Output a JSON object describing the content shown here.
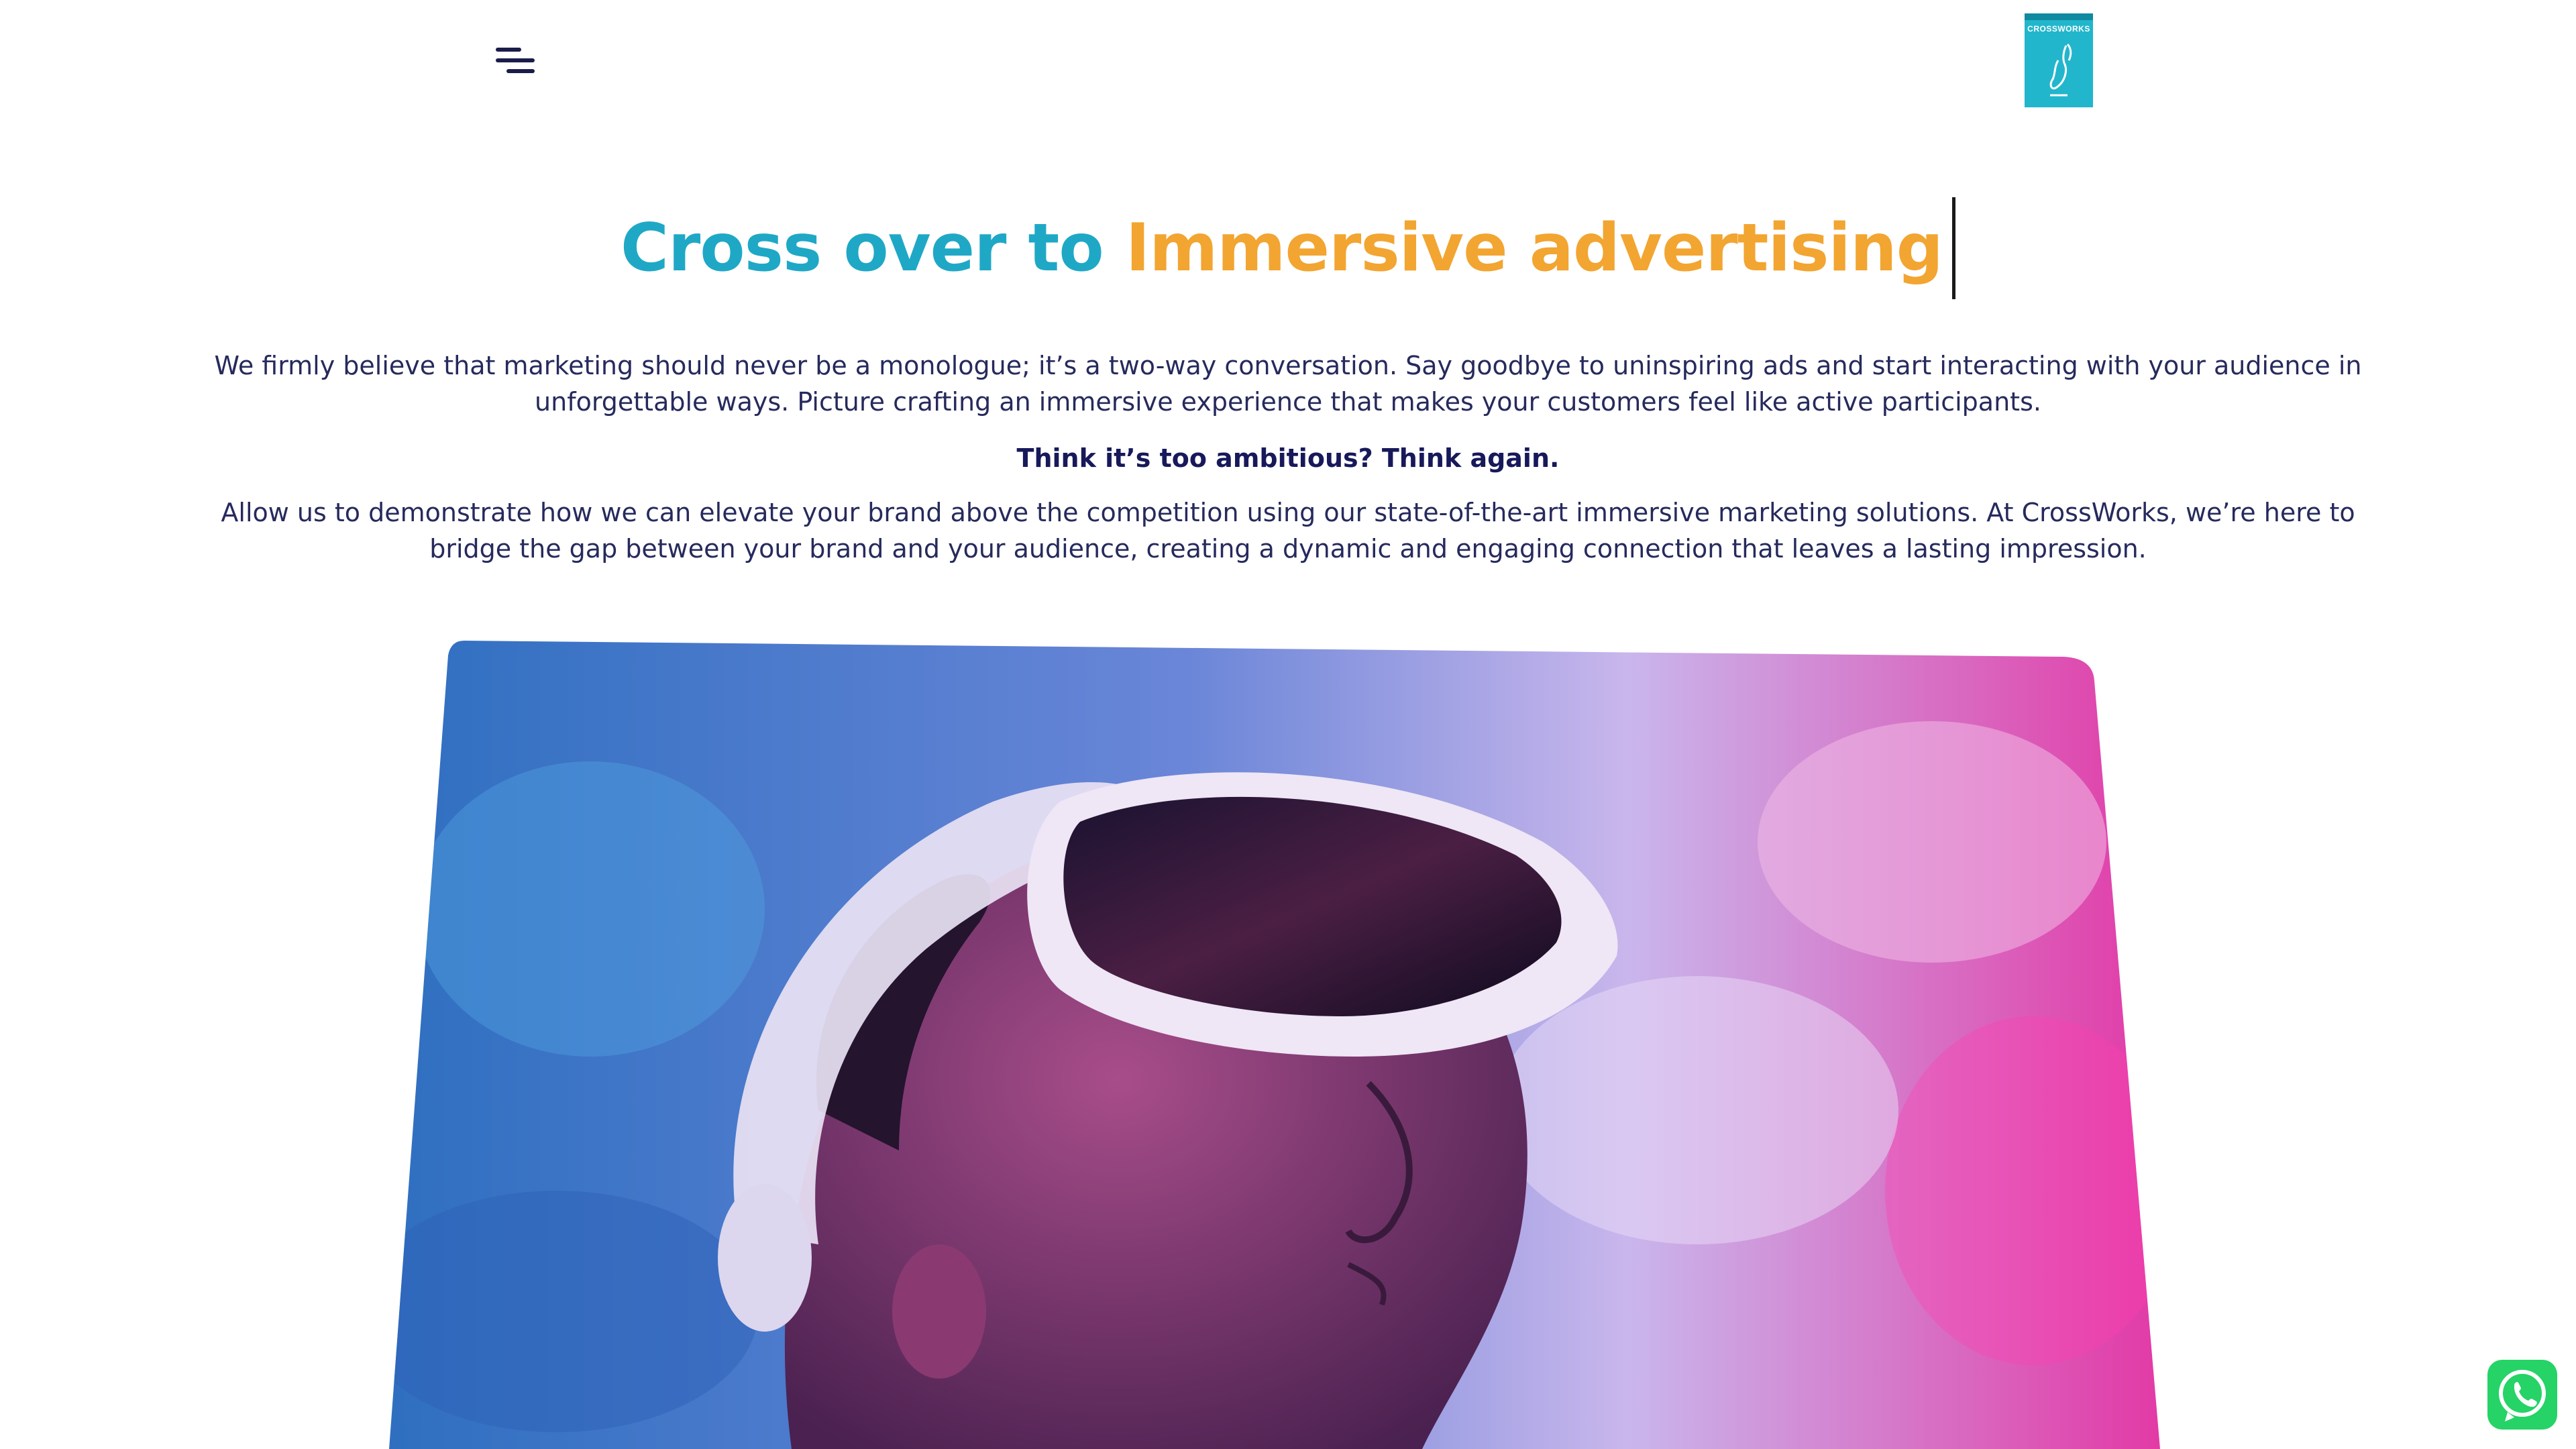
{
  "header": {
    "menu_icon": "hamburger-menu-icon",
    "logo_text": "CROSSWORKS"
  },
  "hero": {
    "headline_part1": "Cross over to",
    "headline_part2": "Immersive advertising",
    "paragraph1": "We firmly believe that marketing should never be a monologue; it’s a two-way conversation. Say goodbye to uninspiring ads and start interacting with your audience in unforgettable ways. Picture crafting an immersive experience that makes your customers feel like active participants.",
    "tagline": "Think it’s too ambitious? Think again.",
    "paragraph2": "Allow us to demonstrate how we can elevate your brand above the competition using our state-of-the-art immersive marketing solutions. At CrossWorks, we’re here to bridge the gap between your brand and your audience, creating a dynamic and engaging connection that leaves a lasting impression."
  },
  "floating": {
    "whatsapp_icon": "whatsapp-icon"
  },
  "colors": {
    "accent_blue": "#1fa8c6",
    "accent_orange": "#f2a531",
    "text_navy": "#262a5c",
    "whatsapp_green": "#25d366"
  }
}
